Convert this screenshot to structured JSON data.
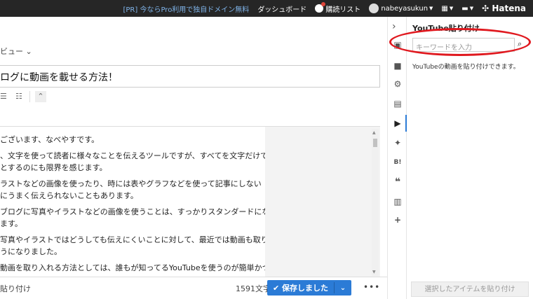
{
  "topbar": {
    "promo": "[PR] 今ならPro利用で独自ドメイン無料",
    "dashboard": "ダッシュボード",
    "reading_list": "購読リスト",
    "user": "nabeyasukun",
    "brand": "Hatena"
  },
  "editor": {
    "mode_label": "ビュー",
    "title": "ログに動画を載せる方法！",
    "paragraphs": [
      "ございます、なべやすです。",
      "、文字を使って読者に様々なことを伝えるツールですが、すべてを文字だけで",
      "とするのにも限界を感じます。",
      "ラストなどの画像を使ったり、時には表やグラフなどを使って記事にしない",
      "にうまく伝えられないこともあります。",
      "ブログに写真やイラストなどの画像を使うことは、すっかりスタンダードにな",
      "ます。",
      "写真やイラストではどうしても伝えにくいことに対して、最近では動画も取り",
      "うになりました。",
      "動画を取り入れる方法としては、誰もが知ってるYouTubeを使うのが簡単かつ"
    ],
    "paste_label": "貼り付け",
    "char_count": "1591文字",
    "save_label": "✔ 保存しました",
    "more_label": "•••"
  },
  "panel": {
    "title": "YouTube貼り付け",
    "search_placeholder": "キーワードを入力",
    "description": "YouTubeの動画を貼り付けできます。",
    "insert_label": "選択したアイテムを貼り付け"
  },
  "colors": {
    "accent": "#2b7bd6",
    "annotation": "#e0191f"
  }
}
